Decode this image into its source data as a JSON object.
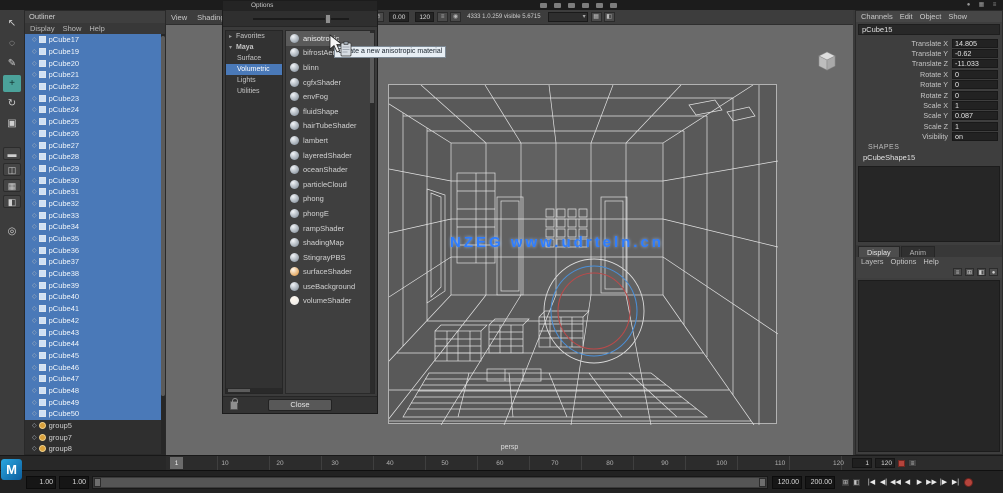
{
  "colors": {
    "selection": "#4a79b8",
    "watermark": "#2e7dff",
    "tooltip_bg": "#e7eef4",
    "node_orange": "#d98a2c",
    "active_tool": "#4ba29a"
  },
  "app": {
    "watermark": "NZEG www.udrteln.cn",
    "persp_label": "persp"
  },
  "topbar": {
    "icons": [
      "file",
      "grid",
      "snap",
      "layout",
      "render",
      "help"
    ],
    "right_icons": [
      "●",
      "▦",
      "≡"
    ]
  },
  "toolbox": {
    "tools": [
      {
        "name": "select-tool",
        "glyph": "↖"
      },
      {
        "name": "lasso-tool",
        "glyph": "◌"
      },
      {
        "name": "paint-select-tool",
        "glyph": "✎"
      },
      {
        "name": "move-tool",
        "glyph": "+",
        "active": true
      },
      {
        "name": "rotate-tool",
        "glyph": "↻"
      },
      {
        "name": "scale-tool",
        "glyph": "▣"
      }
    ],
    "layouts": [
      {
        "name": "layout-single-pane",
        "glyph": "▬"
      },
      {
        "name": "layout-two-pane",
        "glyph": "◫"
      },
      {
        "name": "layout-four-pane",
        "glyph": "▦"
      },
      {
        "name": "layout-outliner-persp",
        "glyph": "◧"
      }
    ],
    "zoom": {
      "name": "zoom-tool",
      "glyph": "◎"
    }
  },
  "outliner": {
    "title": "Outliner",
    "menus": [
      "Display",
      "Show",
      "Help"
    ],
    "items": [
      {
        "label": "pCube17",
        "selected": true
      },
      {
        "label": "pCube19",
        "selected": true
      },
      {
        "label": "pCube20",
        "selected": true
      },
      {
        "label": "pCube21",
        "selected": true
      },
      {
        "label": "pCube22",
        "selected": true
      },
      {
        "label": "pCube23",
        "selected": true
      },
      {
        "label": "pCube24",
        "selected": true
      },
      {
        "label": "pCube25",
        "selected": true
      },
      {
        "label": "pCube26",
        "selected": true
      },
      {
        "label": "pCube27",
        "selected": true
      },
      {
        "label": "pCube28",
        "selected": true
      },
      {
        "label": "pCube29",
        "selected": true
      },
      {
        "label": "pCube30",
        "selected": true
      },
      {
        "label": "pCube31",
        "selected": true
      },
      {
        "label": "pCube32",
        "selected": true
      },
      {
        "label": "pCube33",
        "selected": true
      },
      {
        "label": "pCube34",
        "selected": true
      },
      {
        "label": "pCube35",
        "selected": true
      },
      {
        "label": "pCube36",
        "selected": true
      },
      {
        "label": "pCube37",
        "selected": true
      },
      {
        "label": "pCube38",
        "selected": true
      },
      {
        "label": "pCube39",
        "selected": true
      },
      {
        "label": "pCube40",
        "selected": true
      },
      {
        "label": "pCube41",
        "selected": true
      },
      {
        "label": "pCube42",
        "selected": true
      },
      {
        "label": "pCube43",
        "selected": true
      },
      {
        "label": "pCube44",
        "selected": true
      },
      {
        "label": "pCube45",
        "selected": true
      },
      {
        "label": "pCube46",
        "selected": true
      },
      {
        "label": "pCube47",
        "selected": true
      },
      {
        "label": "pCube48",
        "selected": true
      },
      {
        "label": "pCube49",
        "selected": true
      },
      {
        "label": "pCube50",
        "selected": true
      },
      {
        "label": "group5",
        "selected": false,
        "kind": "group"
      },
      {
        "label": "group7",
        "selected": false,
        "kind": "group"
      },
      {
        "label": "group8",
        "selected": false,
        "kind": "group"
      }
    ]
  },
  "panel": {
    "menus": [
      "View",
      "Shading"
    ],
    "toolbar": [
      {
        "t": "icon",
        "g": "⊡",
        "n": "snap-grid-icon"
      },
      {
        "t": "icon",
        "g": "⊞",
        "n": "snap-curve-icon"
      },
      {
        "t": "icon",
        "g": "◈",
        "n": "snap-point-icon"
      },
      {
        "t": "icon",
        "g": "⊕",
        "n": "snap-view-icon"
      },
      {
        "t": "icon",
        "g": "⊘",
        "n": "make-live-icon"
      },
      {
        "t": "field",
        "v": "0.00",
        "n": "input-field"
      },
      {
        "t": "field",
        "v": "120",
        "n": "frames-field"
      },
      {
        "t": "icon",
        "g": "≡",
        "n": "construction-history-icon"
      },
      {
        "t": "icon",
        "g": "◉",
        "n": "render-view-icon"
      },
      {
        "t": "text",
        "v": "4333 1.0.259 visible 5.6715",
        "n": "heads-up-readout"
      },
      {
        "t": "select",
        "n": "camera-select"
      },
      {
        "t": "icon",
        "g": "▦",
        "n": "grid-toggle-icon"
      },
      {
        "t": "icon",
        "g": "◧",
        "n": "panel-layout-icon"
      }
    ]
  },
  "dialog": {
    "title": "Options",
    "categories": [
      {
        "label": "Favorites",
        "arrow": "▸"
      },
      {
        "label": "Maya",
        "arrow": "▾",
        "bold": true
      },
      {
        "label": "Surface",
        "indent": 1
      },
      {
        "label": "Volumetric",
        "indent": 1,
        "selected": true
      },
      {
        "label": "Lights",
        "indent": 1
      },
      {
        "label": "Utilities",
        "indent": 1
      }
    ],
    "materials": [
      {
        "label": "anisotropic",
        "hover": true
      },
      {
        "label": "bifrostAeroMaterial"
      },
      {
        "label": "blinn"
      },
      {
        "label": "cgfxShader"
      },
      {
        "label": "envFog"
      },
      {
        "label": "fluidShape"
      },
      {
        "label": "hairTubeShader"
      },
      {
        "label": "lambert"
      },
      {
        "label": "layeredShader"
      },
      {
        "label": "oceanShader"
      },
      {
        "label": "particleCloud"
      },
      {
        "label": "phong"
      },
      {
        "label": "phongE"
      },
      {
        "label": "rampShader"
      },
      {
        "label": "shadingMap"
      },
      {
        "label": "StingrayPBS"
      },
      {
        "label": "surfaceShader",
        "color": "#d98a2c"
      },
      {
        "label": "useBackground"
      },
      {
        "label": "volumeShader",
        "color": "#e8e8e8"
      }
    ],
    "tooltip": "Create a new anisotropic material",
    "close_label": "Close"
  },
  "channel_box": {
    "menus": [
      "Channels",
      "Edit",
      "Object",
      "Show"
    ],
    "object_name": "pCube15",
    "rows": [
      {
        "label": "Translate X",
        "value": "14.805"
      },
      {
        "label": "Translate Y",
        "value": "-0.62"
      },
      {
        "label": "Translate Z",
        "value": "-11.033"
      },
      {
        "label": "Rotate X",
        "value": "0"
      },
      {
        "label": "Rotate Y",
        "value": "0"
      },
      {
        "label": "Rotate Z",
        "value": "0"
      },
      {
        "label": "Scale X",
        "value": "1"
      },
      {
        "label": "Scale Y",
        "value": "0.087"
      },
      {
        "label": "Scale Z",
        "value": "1"
      },
      {
        "label": "Visibility",
        "value": "on"
      }
    ],
    "shapes_label": "SHAPES",
    "shape_name": "pCubeShape15"
  },
  "layer_editor": {
    "tabs": [
      "Display",
      "Anim"
    ],
    "active_tab": 0,
    "menus": [
      "Layers",
      "Options",
      "Help"
    ],
    "icons": [
      "≡",
      "⊞",
      "◧",
      "●"
    ]
  },
  "timeline": {
    "ticks": [
      "1",
      "10",
      "20",
      "30",
      "40",
      "50",
      "60",
      "70",
      "80",
      "90",
      "100",
      "110",
      "120"
    ],
    "current_frame": "1",
    "end_frame": "120"
  },
  "range": {
    "fields_left": [
      "1.00",
      "1.00"
    ],
    "fields_right": [
      "120.00",
      "200.00"
    ]
  },
  "transport": {
    "buttons": [
      {
        "name": "go-to-start-button",
        "glyph": "|◀"
      },
      {
        "name": "step-back-key-button",
        "glyph": "◀|"
      },
      {
        "name": "step-back-frame-button",
        "glyph": "◀◀"
      },
      {
        "name": "play-backwards-button",
        "glyph": "◀"
      },
      {
        "name": "play-forwards-button",
        "glyph": "▶"
      },
      {
        "name": "step-forward-frame-button",
        "glyph": "▶▶"
      },
      {
        "name": "step-forward-key-button",
        "glyph": "|▶"
      },
      {
        "name": "go-to-end-button",
        "glyph": "▶|"
      }
    ]
  }
}
